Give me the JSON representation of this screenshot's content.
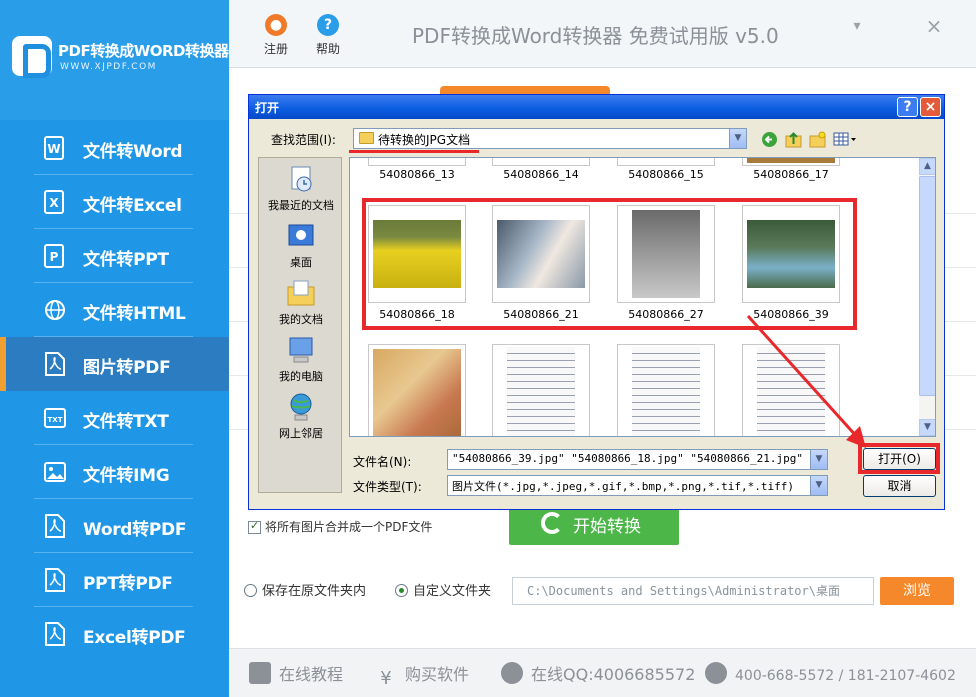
{
  "app": {
    "logo_title": "PDF转换成WORD转换器",
    "logo_url": "WWW.XJPDF.COM",
    "title": "PDF转换成Word转换器 免费试用版 v5.0",
    "register_label": "注册",
    "help_label": "帮助"
  },
  "sidebar": {
    "items": [
      {
        "label": "文件转Word",
        "icon": "word-icon"
      },
      {
        "label": "文件转Excel",
        "icon": "excel-icon"
      },
      {
        "label": "文件转PPT",
        "icon": "ppt-icon"
      },
      {
        "label": "文件转HTML",
        "icon": "globe-icon"
      },
      {
        "label": "图片转PDF",
        "icon": "pdf-icon",
        "active": true
      },
      {
        "label": "文件转TXT",
        "icon": "txt-icon"
      },
      {
        "label": "文件转IMG",
        "icon": "image-icon"
      },
      {
        "label": "Word转PDF",
        "icon": "pdf-icon"
      },
      {
        "label": "PPT转PDF",
        "icon": "pdf-icon"
      },
      {
        "label": "Excel转PDF",
        "icon": "pdf-icon"
      }
    ]
  },
  "main": {
    "merge_label": "将所有图片合并成一个PDF文件",
    "start_label": "开始转换",
    "save_original_label": "保存在原文件夹内",
    "custom_folder_label": "自定义文件夹",
    "path_value": "C:\\Documents and Settings\\Administrator\\桌面",
    "browse_label": "浏览"
  },
  "footer": {
    "tutorial": "在线教程",
    "buy": "购买软件",
    "qq": "在线QQ:4006685572",
    "phone": "400-668-5572 / 181-2107-4602"
  },
  "dialog": {
    "title": "打开",
    "help": "?",
    "close": "×",
    "look_in_label": "查找范围(I):",
    "look_in_value": "待转换的JPG文档",
    "places": [
      "我最近的文档",
      "桌面",
      "我的文档",
      "我的电脑",
      "网上邻居"
    ],
    "top_row": [
      "54080866_13",
      "54080866_14",
      "54080866_15",
      "54080866_17"
    ],
    "selected_row": [
      "54080866_18",
      "54080866_21",
      "54080866_27",
      "54080866_39"
    ],
    "filename_label": "文件名(N):",
    "filename_value": "\"54080866_39.jpg\" \"54080866_18.jpg\" \"54080866_21.jpg\" \"54080",
    "filetype_label": "文件类型(T):",
    "filetype_value": "图片文件(*.jpg,*.jpeg,*.gif,*.bmp,*.png,*.tif,*.tiff)",
    "open_label": "打开(O)",
    "cancel_label": "取消"
  },
  "colors": {
    "sidebar": "#1f97e6",
    "active": "#2b7cc0",
    "accent_orange": "#f5882a",
    "start_green": "#4cb748",
    "highlight_red": "#e8282a",
    "xp_title_blue": "#0a5be0"
  }
}
